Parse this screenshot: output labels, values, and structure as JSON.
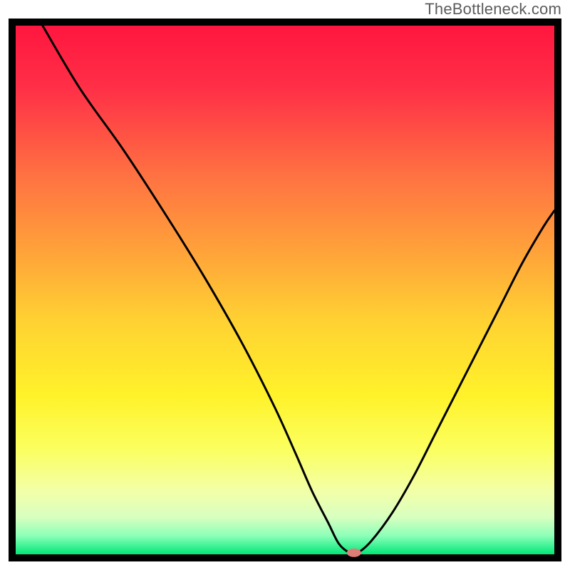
{
  "watermark": "TheBottleneck.com",
  "chart_data": {
    "type": "line",
    "title": "",
    "xlabel": "",
    "ylabel": "",
    "xlim": [
      0,
      100
    ],
    "ylim": [
      0,
      100
    ],
    "grid": false,
    "legend": false,
    "background": "heat-gradient",
    "gradient_stops": [
      {
        "pos": 0.0,
        "color": "#ff163f"
      },
      {
        "pos": 0.12,
        "color": "#ff3047"
      },
      {
        "pos": 0.28,
        "color": "#ff7042"
      },
      {
        "pos": 0.42,
        "color": "#ffa03a"
      },
      {
        "pos": 0.56,
        "color": "#ffd232"
      },
      {
        "pos": 0.7,
        "color": "#fff22a"
      },
      {
        "pos": 0.8,
        "color": "#fbff5e"
      },
      {
        "pos": 0.88,
        "color": "#f3ffa8"
      },
      {
        "pos": 0.93,
        "color": "#d8ffc0"
      },
      {
        "pos": 0.965,
        "color": "#8cffb8"
      },
      {
        "pos": 1.0,
        "color": "#00e878"
      }
    ],
    "series": [
      {
        "name": "bottleneck-curve",
        "stroke": "#000000",
        "x": [
          5,
          12,
          20,
          28,
          35,
          42,
          48,
          52,
          55,
          58,
          60,
          62,
          63.5,
          66,
          70,
          74,
          78,
          82,
          86,
          90,
          94,
          98,
          100
        ],
        "y": [
          100,
          88,
          76.5,
          64,
          52.5,
          40,
          28,
          19,
          12,
          6,
          2,
          0.3,
          0.3,
          2.5,
          8,
          15,
          23,
          31,
          39,
          47,
          55,
          62,
          65
        ]
      }
    ],
    "marker": {
      "x": 62.8,
      "y": 0.3,
      "color": "#e07c78",
      "rx": 10,
      "ry": 6
    }
  }
}
